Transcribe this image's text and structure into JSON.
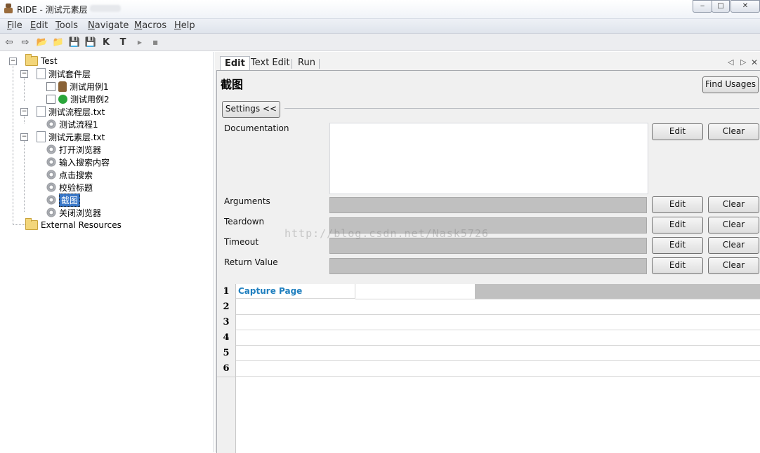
{
  "window": {
    "title": "RIDE - 测试元素层",
    "min": "‒",
    "max": "□",
    "close": "✕"
  },
  "menu": [
    {
      "label": "File",
      "u": "F",
      "rest": "ile"
    },
    {
      "label": "Edit",
      "u": "E",
      "rest": "dit"
    },
    {
      "label": "Tools",
      "u": "T",
      "rest": "ools"
    },
    {
      "label": "Navigate",
      "u": "N",
      "rest": "avigate"
    },
    {
      "label": "Macros",
      "u": "M",
      "rest": "acros"
    },
    {
      "label": "Help",
      "u": "H",
      "rest": "elp"
    }
  ],
  "toolbar": {
    "back": "⇦",
    "forward": "⇨",
    "open": "📂",
    "open_dir": "📁",
    "save": "💾",
    "save_all": "💾",
    "search_keywords": "K",
    "search_tests": "T",
    "run": "▶",
    "stop": "■"
  },
  "tree": {
    "root": "Test",
    "suite": "测试套件层",
    "case1": "测试用例1",
    "case2": "测试用例2",
    "flow_file": "测试流程层.txt",
    "flow1": "测试流程1",
    "elem_file": "测试元素层.txt",
    "kw1": "打开浏览器",
    "kw2": "输入搜索内容",
    "kw3": "点击搜索",
    "kw4": "校验标题",
    "kw5": "截图",
    "kw6": "关闭浏览器",
    "external": "External Resources"
  },
  "tabs": {
    "edit": "Edit",
    "text_edit": "Text Edit",
    "run": "Run"
  },
  "editor": {
    "keyword_name": "截图",
    "find_usages": "Find Usages",
    "settings": "Settings <<",
    "fields": {
      "documentation": "Documentation",
      "arguments": "Arguments",
      "teardown": "Teardown",
      "timeout": "Timeout",
      "return_value": "Return Value"
    },
    "edit_btn": "Edit",
    "clear_btn": "Clear",
    "watermark": "http://blog.csdn.net/Nask5726"
  },
  "grid": {
    "rows": [
      "1",
      "2",
      "3",
      "4",
      "5",
      "6"
    ],
    "cell_1_1": "Capture Page Screenshot"
  }
}
